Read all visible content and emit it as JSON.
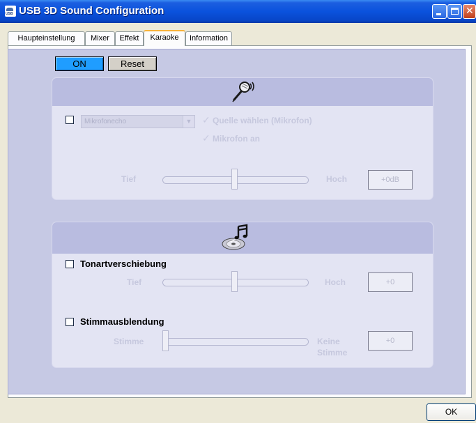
{
  "window": {
    "title": "USB 3D Sound Configuration",
    "icon_label": "USB"
  },
  "tabs": [
    "Haupteinstellung",
    "Mixer",
    "Effekt",
    "Karaoke",
    "Information"
  ],
  "active_tab": "Karaoke",
  "controls": {
    "on_label": "ON",
    "reset_label": "Reset",
    "ok_label": "OK"
  },
  "mic_section": {
    "icon": "microphone-icon",
    "combo_value": "Mikrofonecho",
    "option_source": "Quelle wählen (Mikrofon)",
    "option_mic_on": "Mikrofon an",
    "slider_left": "Tief",
    "slider_right": "Hoch",
    "value": "+0dB",
    "slider_position": 0.5,
    "enabled": false
  },
  "music_section": {
    "icon": "music-cd-icon",
    "key_shift": {
      "label": "Tonartverschiebung",
      "slider_left": "Tief",
      "slider_right": "Hoch",
      "value": "+0",
      "slider_position": 0.5
    },
    "voice_cancel": {
      "label": "Stimmausblendung",
      "slider_left": "Stimme",
      "slider_right_1": "Keine",
      "slider_right_2": "Stimme",
      "value": "+0",
      "slider_position": 0.0
    }
  },
  "colors": {
    "title_bar": "#0a52dd",
    "on_button": "#1f9dff",
    "panel_bg": "#c6c9e4"
  }
}
